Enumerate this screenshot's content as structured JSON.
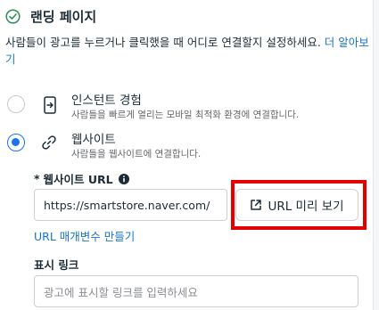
{
  "section": {
    "title": "랜딩 페이지",
    "description": "사람들이 광고를 누르거나 클릭했을 때 어디로 연결할지 설정하세요.",
    "learn_more": "더 알아보기"
  },
  "options": [
    {
      "title": "인스턴트 경험",
      "subtitle": "사람들을 빠르게 열리는 모바일 최적화 환경에 연결합니다.",
      "icon": "instant-experience-icon",
      "selected": false
    },
    {
      "title": "웹사이트",
      "subtitle": "사람들을 웹사이트에 연결합니다.",
      "icon": "link-icon",
      "selected": true
    }
  ],
  "website_url": {
    "required_mark": "*",
    "label": "웹사이트 URL",
    "info_icon": "info-icon",
    "value": "https://smartstore.naver.com/",
    "preview_button": "URL 미리 보기",
    "preview_icon": "external-link-icon",
    "url_params_link": "URL 매개변수 만들기"
  },
  "display_link": {
    "label": "표시 링크",
    "placeholder": "광고에 표시할 링크를 입력하세요"
  },
  "colors": {
    "accent": "#1a73e8",
    "link": "#1876c8",
    "highlight": "#e30000",
    "check": "#2e8b57"
  }
}
